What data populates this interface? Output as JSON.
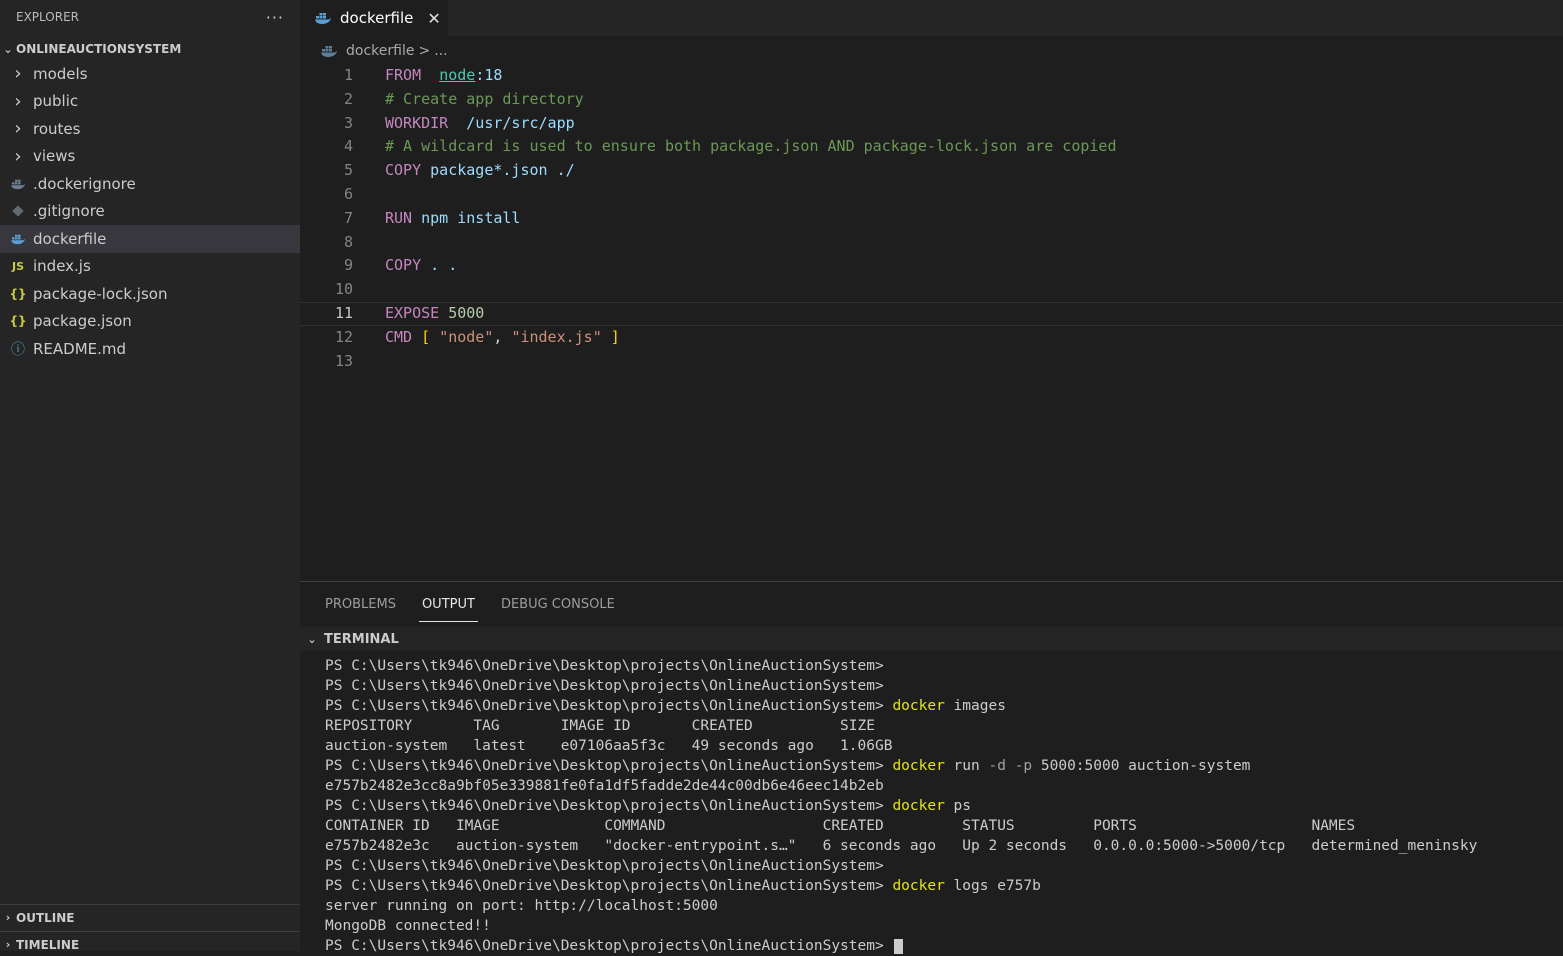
{
  "sidebar": {
    "title": "EXPLORER",
    "more": "···",
    "project": "ONLINEAUCTIONSYSTEM",
    "items": [
      {
        "label": "models",
        "type": "folder",
        "icon": "chevron-right-icon"
      },
      {
        "label": "public",
        "type": "folder",
        "icon": "chevron-right-icon"
      },
      {
        "label": "routes",
        "type": "folder",
        "icon": "chevron-right-icon"
      },
      {
        "label": "views",
        "type": "folder",
        "icon": "chevron-right-icon"
      },
      {
        "label": ".dockerignore",
        "type": "file",
        "icon": "docker-icon"
      },
      {
        "label": ".gitignore",
        "type": "file",
        "icon": "git-icon"
      },
      {
        "label": "dockerfile",
        "type": "file",
        "icon": "docker-icon",
        "selected": true
      },
      {
        "label": "index.js",
        "type": "file",
        "icon": "js-icon",
        "glyph": "JS"
      },
      {
        "label": "package-lock.json",
        "type": "file",
        "icon": "json-icon",
        "glyph": "{}"
      },
      {
        "label": "package.json",
        "type": "file",
        "icon": "json-icon",
        "glyph": "{}"
      },
      {
        "label": "README.md",
        "type": "file",
        "icon": "info-icon",
        "glyph": "ⓘ"
      }
    ],
    "outline": "OUTLINE",
    "timeline": "TIMELINE"
  },
  "editor": {
    "tab_label": "dockerfile",
    "tab_close": "✕",
    "breadcrumb": {
      "file": "dockerfile",
      "sep": ">",
      "rest": "..."
    },
    "lines": [
      {
        "n": "1",
        "tokens": [
          [
            "FROM",
            "kw"
          ],
          [
            "  ",
            "pl"
          ],
          [
            "node",
            "id-u"
          ],
          [
            ":18",
            "id"
          ]
        ]
      },
      {
        "n": "2",
        "tokens": [
          [
            "# Create app directory",
            "cm"
          ]
        ]
      },
      {
        "n": "3",
        "tokens": [
          [
            "WORKDIR",
            "kw"
          ],
          [
            "  ",
            "pl"
          ],
          [
            "/usr/src/app",
            "id"
          ]
        ]
      },
      {
        "n": "4",
        "tokens": [
          [
            "# A wildcard is used to ensure both package.json AND package-lock.json are copied",
            "cm"
          ]
        ]
      },
      {
        "n": "5",
        "tokens": [
          [
            "COPY",
            "kw"
          ],
          [
            " ",
            "pl"
          ],
          [
            "package*.json ./",
            "id"
          ]
        ]
      },
      {
        "n": "6",
        "tokens": []
      },
      {
        "n": "7",
        "tokens": [
          [
            "RUN",
            "kw"
          ],
          [
            " ",
            "pl"
          ],
          [
            "npm install",
            "id"
          ]
        ]
      },
      {
        "n": "8",
        "tokens": []
      },
      {
        "n": "9",
        "tokens": [
          [
            "COPY",
            "kw"
          ],
          [
            " ",
            "pl"
          ],
          [
            ". .",
            "id"
          ]
        ]
      },
      {
        "n": "10",
        "tokens": []
      },
      {
        "n": "11",
        "tokens": [
          [
            "EXPOSE",
            "kw"
          ],
          [
            " ",
            "pl"
          ],
          [
            "5000",
            "num"
          ]
        ],
        "current": true
      },
      {
        "n": "12",
        "tokens": [
          [
            "CMD",
            "kw"
          ],
          [
            " ",
            "pl"
          ],
          [
            "[",
            "brk"
          ],
          [
            " ",
            "pl"
          ],
          [
            "\"node\"",
            "str"
          ],
          [
            ", ",
            "pl"
          ],
          [
            "\"index.js\"",
            "str"
          ],
          [
            " ",
            "pl"
          ],
          [
            "]",
            "brk"
          ]
        ]
      },
      {
        "n": "13",
        "tokens": []
      }
    ]
  },
  "panel": {
    "tabs": [
      {
        "label": "PROBLEMS",
        "active": false
      },
      {
        "label": "OUTPUT",
        "active": true
      },
      {
        "label": "DEBUG CONSOLE",
        "active": false
      }
    ],
    "terminal_title": "TERMINAL",
    "terminal_lines": [
      [
        [
          "PS C:\\Users\\tk946\\OneDrive\\Desktop\\projects\\OnlineAuctionSystem>",
          ""
        ]
      ],
      [
        [
          "PS C:\\Users\\tk946\\OneDrive\\Desktop\\projects\\OnlineAuctionSystem>",
          ""
        ]
      ],
      [
        [
          "PS C:\\Users\\tk946\\OneDrive\\Desktop\\projects\\OnlineAuctionSystem> ",
          ""
        ],
        [
          "docker",
          "tcmd"
        ],
        [
          " images",
          ""
        ]
      ],
      [
        [
          "REPOSITORY       TAG       IMAGE ID       CREATED          SIZE",
          ""
        ]
      ],
      [
        [
          "auction-system   latest    e07106aa5f3c   49 seconds ago   1.06GB",
          ""
        ]
      ],
      [
        [
          "PS C:\\Users\\tk946\\OneDrive\\Desktop\\projects\\OnlineAuctionSystem> ",
          ""
        ],
        [
          "docker",
          "tcmd"
        ],
        [
          " run ",
          ""
        ],
        [
          "-d",
          "tflag"
        ],
        [
          " ",
          ""
        ],
        [
          "-p",
          "tflag"
        ],
        [
          " 5000:5000 auction-system",
          ""
        ]
      ],
      [
        [
          "e757b2482e3cc8a9bf05e339881fe0fa1df5fadde2de44c00db6e46eec14b2eb",
          ""
        ]
      ],
      [
        [
          "PS C:\\Users\\tk946\\OneDrive\\Desktop\\projects\\OnlineAuctionSystem> ",
          ""
        ],
        [
          "docker",
          "tcmd"
        ],
        [
          " ps",
          ""
        ]
      ],
      [
        [
          "CONTAINER ID   IMAGE            COMMAND                  CREATED         STATUS         PORTS                    NAMES",
          ""
        ]
      ],
      [
        [
          "e757b2482e3c   auction-system   \"docker-entrypoint.s…\"   6 seconds ago   Up 2 seconds   0.0.0.0:5000->5000/tcp   determined_meninsky",
          ""
        ]
      ],
      [
        [
          "PS C:\\Users\\tk946\\OneDrive\\Desktop\\projects\\OnlineAuctionSystem>",
          ""
        ]
      ],
      [
        [
          "PS C:\\Users\\tk946\\OneDrive\\Desktop\\projects\\OnlineAuctionSystem> ",
          ""
        ],
        [
          "docker",
          "tcmd"
        ],
        [
          " logs e757b",
          ""
        ]
      ],
      [
        [
          "server running on port: http://localhost:5000",
          ""
        ]
      ],
      [
        [
          "MongoDB connected!!",
          ""
        ]
      ],
      [
        [
          "PS C:\\Users\\tk946\\OneDrive\\Desktop\\projects\\OnlineAuctionSystem> ",
          ""
        ]
      ]
    ]
  }
}
